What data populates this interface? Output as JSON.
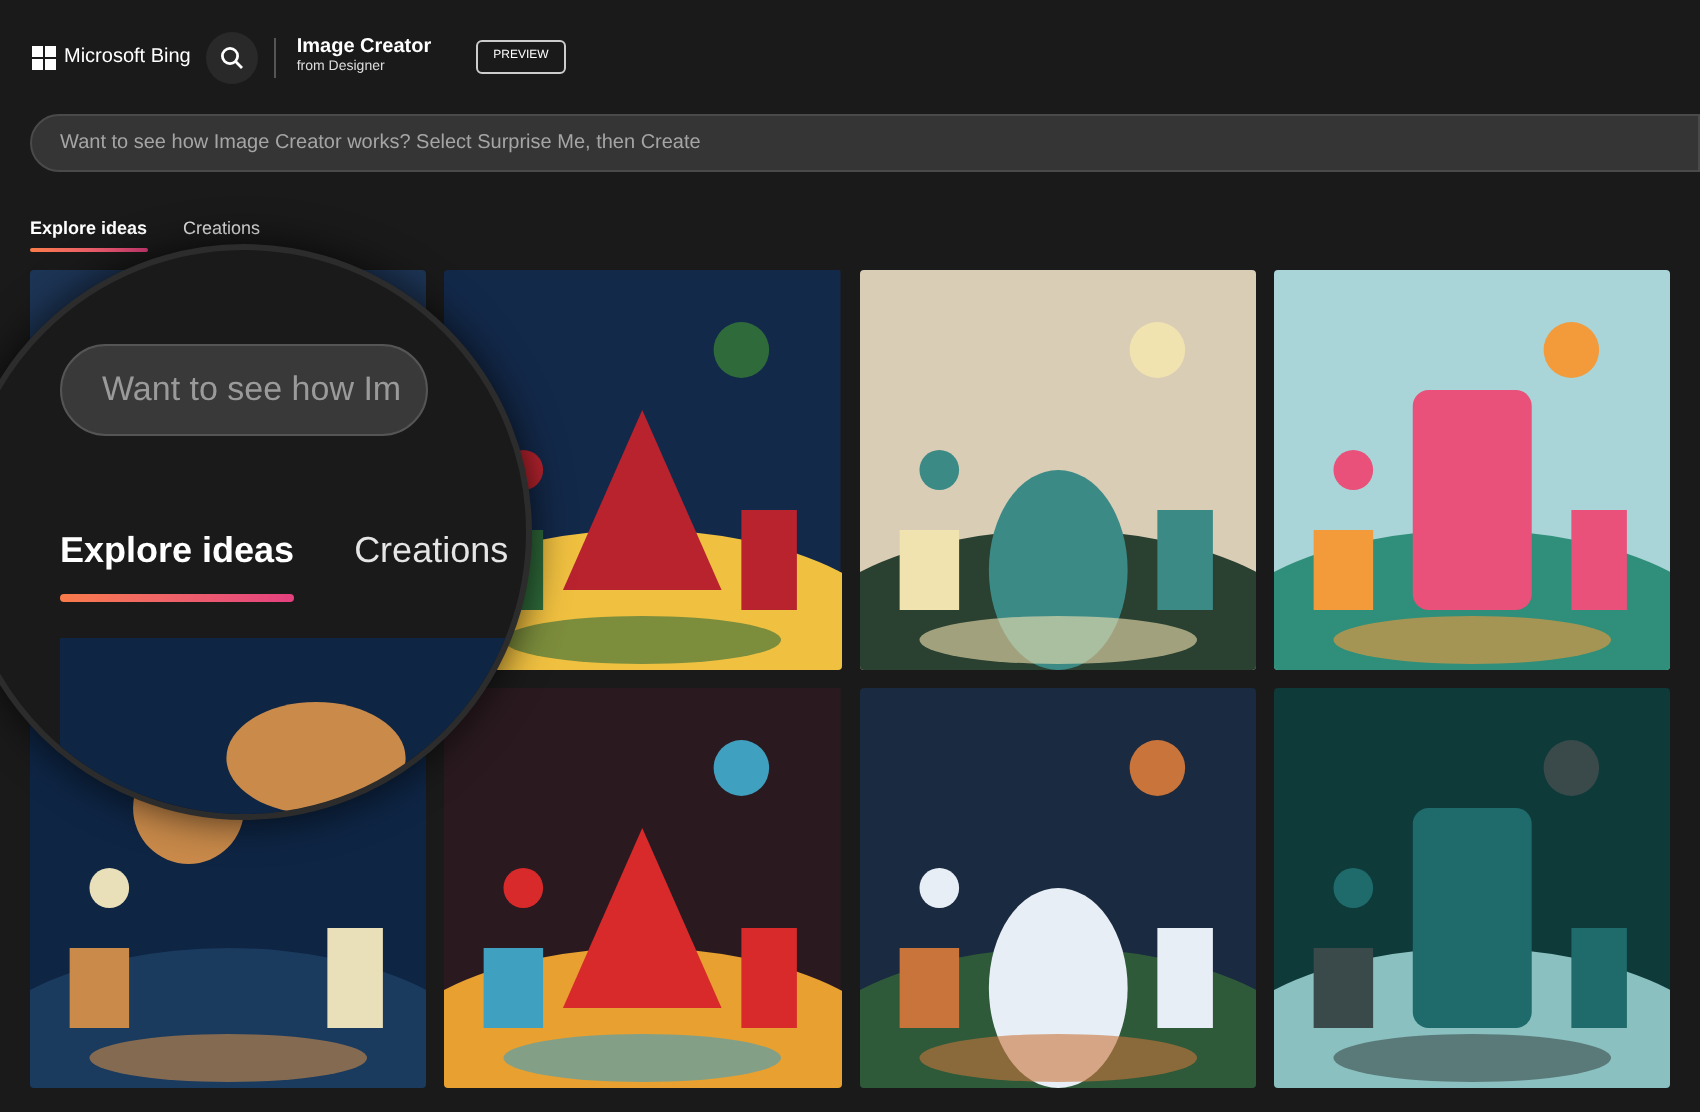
{
  "header": {
    "brand": "Microsoft Bing",
    "product_title": "Image Creator",
    "product_subtitle": "from Designer",
    "badge": "PREVIEW"
  },
  "search": {
    "placeholder": "Want to see how Image Creator works? Select Surprise Me, then Create"
  },
  "tabs": [
    {
      "label": "Explore ideas",
      "selected": true
    },
    {
      "label": "Creations",
      "selected": false
    }
  ],
  "magnifier": {
    "search_text": "Want to see how Im",
    "tabs": [
      {
        "label": "Explore ideas",
        "selected": true
      },
      {
        "label": "Creations",
        "selected": false
      }
    ]
  }
}
